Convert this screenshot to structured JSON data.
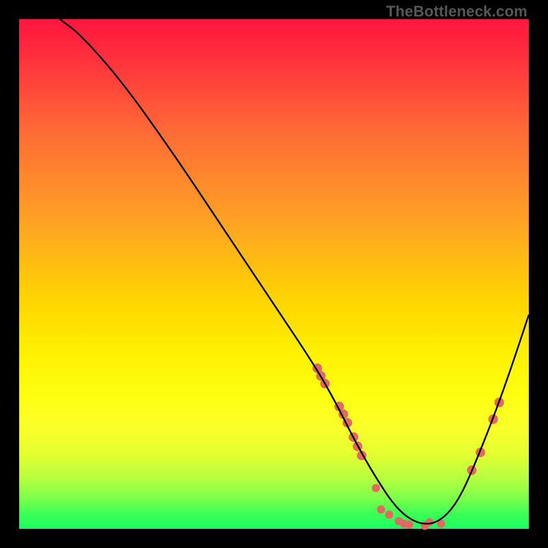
{
  "watermark": "TheBottleneck.com",
  "chart_data": {
    "type": "line",
    "title": "",
    "xlabel": "",
    "ylabel": "",
    "xlim": [
      0,
      100
    ],
    "ylim": [
      0,
      100
    ],
    "grid": false,
    "legend": false,
    "series": [
      {
        "name": "curve",
        "x": [
          8,
          12,
          20,
          30,
          40,
          50,
          58,
          62,
          66,
          70,
          74,
          78,
          82,
          86,
          90,
          95,
          100
        ],
        "y": [
          100,
          97,
          88,
          74,
          59,
          44,
          32,
          25,
          17,
          10,
          4,
          1,
          1,
          5,
          14,
          27,
          42
        ]
      }
    ],
    "markers": [
      {
        "x": 58.5,
        "y": 31.5,
        "r": 7
      },
      {
        "x": 59.2,
        "y": 30.0,
        "r": 7
      },
      {
        "x": 60.0,
        "y": 28.5,
        "r": 7
      },
      {
        "x": 62.8,
        "y": 24.0,
        "r": 7
      },
      {
        "x": 63.6,
        "y": 22.5,
        "r": 7
      },
      {
        "x": 64.4,
        "y": 20.8,
        "r": 7
      },
      {
        "x": 65.6,
        "y": 18.0,
        "r": 7
      },
      {
        "x": 66.4,
        "y": 16.2,
        "r": 7
      },
      {
        "x": 67.2,
        "y": 14.4,
        "r": 7
      },
      {
        "x": 70.0,
        "y": 8.0,
        "r": 6
      },
      {
        "x": 71.0,
        "y": 3.8,
        "r": 6
      },
      {
        "x": 72.6,
        "y": 2.8,
        "r": 6
      },
      {
        "x": 74.5,
        "y": 1.5,
        "r": 6
      },
      {
        "x": 75.5,
        "y": 1.0,
        "r": 6
      },
      {
        "x": 76.5,
        "y": 0.8,
        "r": 6
      },
      {
        "x": 79.6,
        "y": 0.6,
        "r": 6
      },
      {
        "x": 80.5,
        "y": 1.3,
        "r": 6
      },
      {
        "x": 82.8,
        "y": 1.0,
        "r": 6
      },
      {
        "x": 88.8,
        "y": 11.5,
        "r": 7
      },
      {
        "x": 90.5,
        "y": 15.0,
        "r": 7
      },
      {
        "x": 93.0,
        "y": 21.5,
        "r": 7
      },
      {
        "x": 94.2,
        "y": 24.8,
        "r": 7
      }
    ],
    "background_gradient": {
      "top": "#ff163f",
      "bottom": "#1aff63"
    }
  }
}
